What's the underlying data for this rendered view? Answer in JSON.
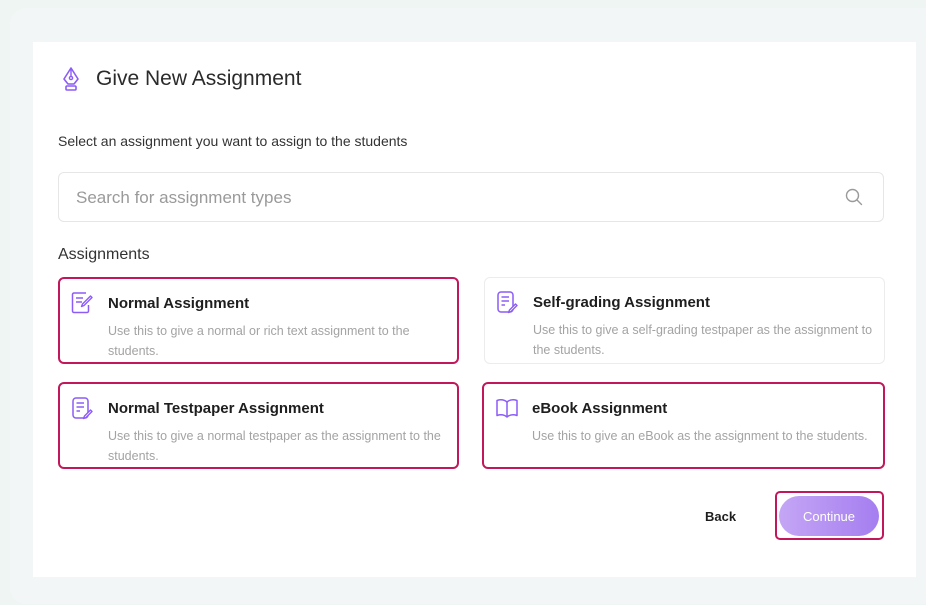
{
  "dialog": {
    "title": "Give New Assignment",
    "subtitle": "Select an assignment you want to assign to the students"
  },
  "search": {
    "placeholder": "Search for assignment types",
    "value": "",
    "icon": "search-icon"
  },
  "section_label": "Assignments",
  "cards": [
    {
      "title": "Normal Assignment",
      "description": "Use this to give a normal or rich text assignment to the students.",
      "icon": "edit-document-icon"
    },
    {
      "title": "Self-grading Assignment",
      "description": "Use this to give a self-grading testpaper as the assignment to the students.",
      "icon": "document-edit-icon"
    },
    {
      "title": "Normal Testpaper Assignment",
      "description": "Use this to give a normal testpaper as the assignment to the students.",
      "icon": "testpaper-icon"
    },
    {
      "title": "eBook Assignment",
      "description": "Use this to give an eBook as the assignment to the students.",
      "icon": "book-icon"
    }
  ],
  "actions": {
    "back_label": "Back",
    "continue_label": "Continue"
  },
  "colors": {
    "accent": "#8b5cf6",
    "highlight": "#c2185b"
  }
}
